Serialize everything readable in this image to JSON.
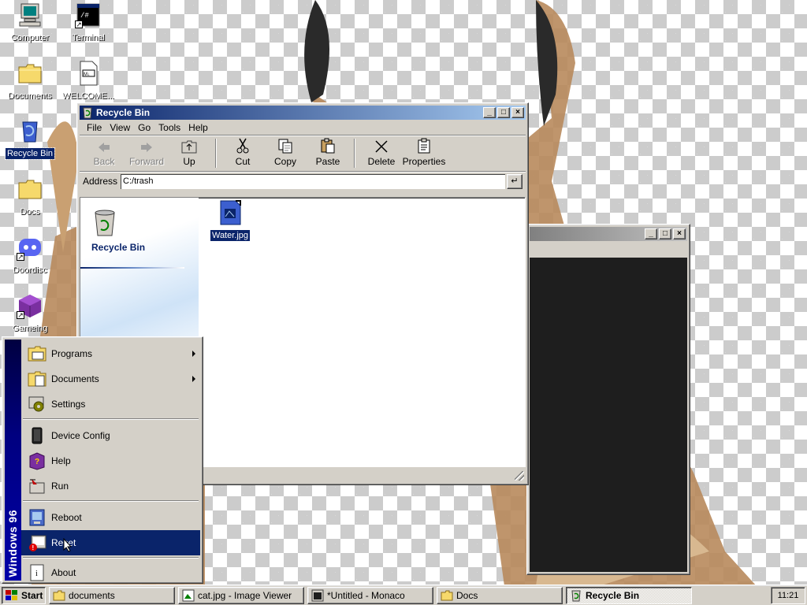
{
  "desktop": {
    "icons": [
      {
        "label": "Computer",
        "icon": "computer-icon"
      },
      {
        "label": "Terminal",
        "icon": "terminal-icon"
      },
      {
        "label": "Documents",
        "icon": "folder-icon"
      },
      {
        "label": "WELCOME...",
        "icon": "markdown-file-icon"
      },
      {
        "label": "Recycle Bin",
        "icon": "recycle-bin-icon"
      },
      {
        "label": "Docs",
        "icon": "folder-icon"
      },
      {
        "label": "Doordisc",
        "icon": "chat-app-icon"
      },
      {
        "label": "Gameing",
        "icon": "cube-icon"
      }
    ]
  },
  "recycle_bin_window": {
    "title": "Recycle Bin",
    "menu": [
      "File",
      "View",
      "Go",
      "Tools",
      "Help"
    ],
    "toolbar": {
      "back": "Back",
      "forward": "Forward",
      "up": "Up",
      "cut": "Cut",
      "copy": "Copy",
      "paste": "Paste",
      "delete": "Delete",
      "properties": "Properties"
    },
    "address_label": "Address",
    "address_value": "C:/trash",
    "sidebar_title": "Recycle Bin",
    "files": [
      {
        "name": "Water.jpg",
        "icon": "image-file-icon"
      }
    ]
  },
  "start_menu": {
    "brand": "Windows 96",
    "items": [
      {
        "label": "Programs",
        "icon": "programs-icon",
        "submenu": true
      },
      {
        "label": "Documents",
        "icon": "documents-icon",
        "submenu": true
      },
      {
        "label": "Settings",
        "icon": "settings-icon"
      },
      {
        "label": "Device Config",
        "icon": "device-icon"
      },
      {
        "label": "Help",
        "icon": "help-book-icon"
      },
      {
        "label": "Run",
        "icon": "run-icon"
      },
      {
        "label": "Reboot",
        "icon": "reboot-icon"
      },
      {
        "label": "Reset",
        "icon": "reset-icon",
        "highlighted": true
      },
      {
        "label": "About",
        "icon": "about-icon"
      }
    ]
  },
  "taskbar": {
    "start_label": "Start",
    "tasks": [
      {
        "label": "documents",
        "icon": "folder-icon"
      },
      {
        "label": "cat.jpg - Image Viewer",
        "icon": "image-viewer-icon"
      },
      {
        "label": "*Untitled - Monaco",
        "icon": "editor-icon"
      },
      {
        "label": "Docs",
        "icon": "folder-icon"
      },
      {
        "label": "Recycle Bin",
        "icon": "recycle-bin-icon",
        "active": true
      }
    ],
    "clock": "11:21"
  },
  "colors": {
    "title_active": "#0a246a",
    "face": "#d4d0c8",
    "highlight": "#0a246a",
    "editor_bg": "#1e1e1e"
  }
}
